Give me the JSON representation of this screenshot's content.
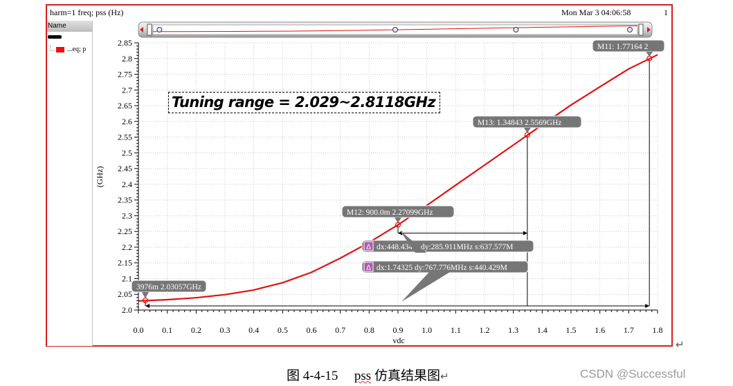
{
  "window": {
    "title": "harm=1 freq; pss (Hz)",
    "datetime": "Mon Mar 3 04:06:58",
    "page_number": "1"
  },
  "sidebar": {
    "header": "Name",
    "signal_label": "...eq; p"
  },
  "annotation": "Tuning range = 2.029~2.8118GHz",
  "markers": [
    {
      "id": "M11",
      "label": "M11: 1.77164 2"
    },
    {
      "id": "M13",
      "label": "M13: 1.34843 2.5569GHz"
    },
    {
      "id": "M12",
      "label": "M12: 900.0m 2.27099GHz"
    },
    {
      "id": "M14",
      "label": "3976m 2.03057GHz"
    }
  ],
  "deltas": [
    {
      "label": "dx:448.434m dy:285.911MHz s:637.577M"
    },
    {
      "label": "dx:1.74325 dy:767.776MHz s:440.429M"
    }
  ],
  "caption": {
    "prefix": "图 4-4-15",
    "pss": "pss",
    "suffix": "仿真结果图"
  },
  "watermark": "CSDN @Successful",
  "colors": {
    "trace": "#e01010",
    "frame": "#d81e1e",
    "marker_fill": "#767676",
    "delta_icon": "#b05ab0"
  },
  "chart_data": {
    "type": "line",
    "xlabel": "vdc",
    "ylabel": "(GHz)",
    "xlim": [
      0.0,
      1.8
    ],
    "ylim": [
      2.0,
      2.85
    ],
    "x_ticks": [
      "0.0",
      "0.1",
      "0.2",
      "0.3",
      "0.4",
      "0.5",
      "0.6",
      "0.7",
      "0.8",
      "0.9",
      "1.0",
      "1.1",
      "1.2",
      "1.3",
      "1.4",
      "1.5",
      "1.6",
      "1.7",
      "1.8"
    ],
    "y_ticks": [
      "2.0",
      "2.05",
      "2.1",
      "2.15",
      "2.2",
      "2.25",
      "2.3",
      "2.35",
      "2.4",
      "2.45",
      "2.5",
      "2.55",
      "2.6",
      "2.65",
      "2.7",
      "2.75",
      "2.8",
      "2.85"
    ],
    "grid": true,
    "series": [
      {
        "x": [
          0.0,
          0.1,
          0.2,
          0.3,
          0.4,
          0.5,
          0.6,
          0.7,
          0.8,
          0.9,
          1.0,
          1.1,
          1.2,
          1.3,
          1.4,
          1.5,
          1.6,
          1.7,
          1.8
        ],
        "y": [
          2.029,
          2.033,
          2.039,
          2.049,
          2.064,
          2.087,
          2.12,
          2.165,
          2.215,
          2.271,
          2.333,
          2.397,
          2.461,
          2.525,
          2.589,
          2.652,
          2.71,
          2.767,
          2.812
        ]
      }
    ],
    "marker_points": [
      {
        "x": 0.023976,
        "y": 2.03057
      },
      {
        "x": 0.9,
        "y": 2.27099
      },
      {
        "x": 1.34843,
        "y": 2.5569
      },
      {
        "x": 1.77164,
        "y": 2.8
      }
    ]
  }
}
